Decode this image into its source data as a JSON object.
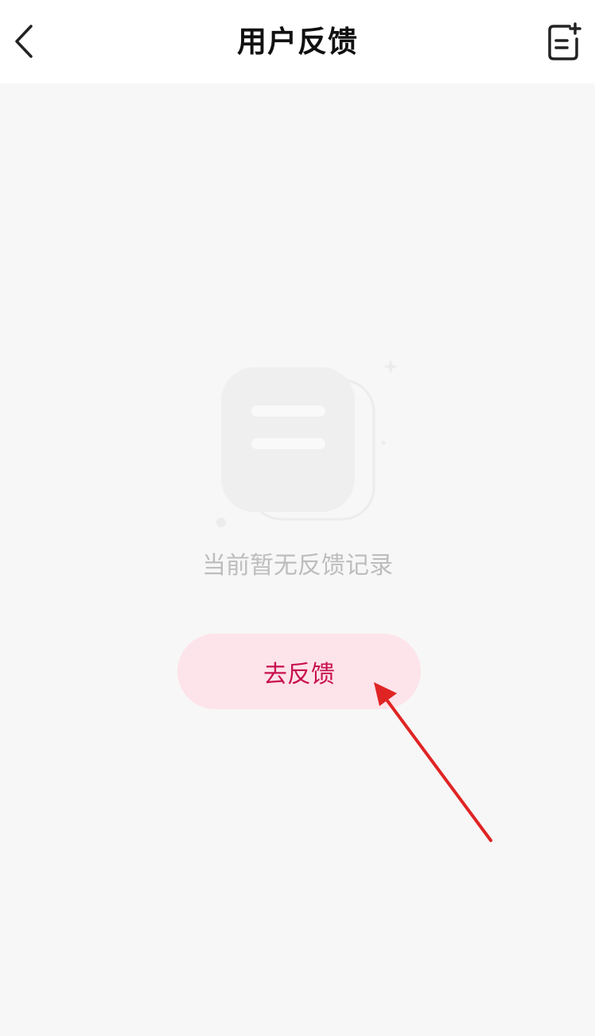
{
  "header": {
    "back_icon": "chevron-left-icon",
    "title": "用户反馈",
    "action_icon": "note-add-icon"
  },
  "empty_state": {
    "illustration_icon": "empty-document-icon",
    "message": "当前暂无反馈记录",
    "button_label": "去反馈"
  },
  "colors": {
    "header_bg": "#ffffff",
    "page_bg": "#f7f7f7",
    "button_bg": "#fde3ea",
    "button_text": "#c8104f",
    "empty_text": "#bdbdbd",
    "annotation_arrow": "#e02424"
  }
}
